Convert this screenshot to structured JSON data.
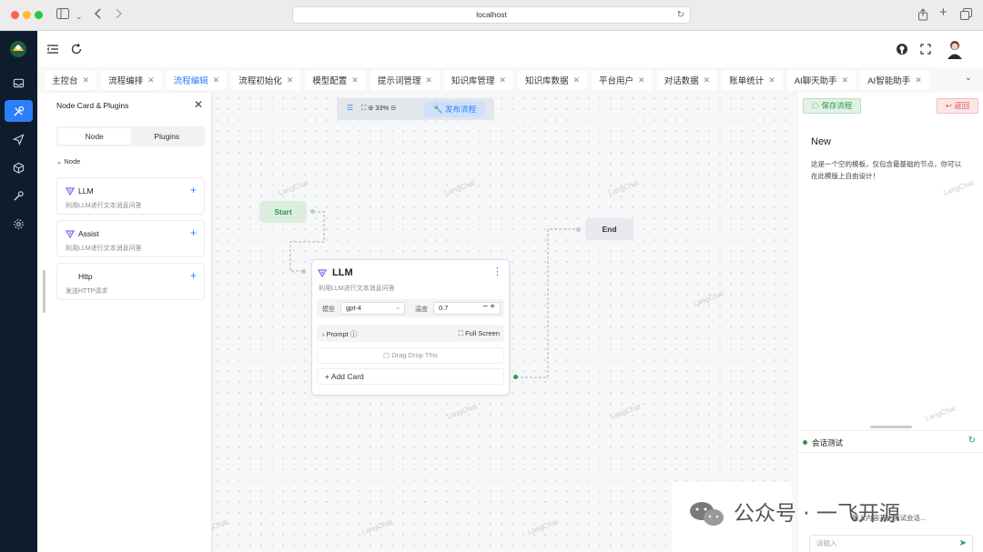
{
  "browser": {
    "url": "localhost"
  },
  "header": {},
  "tabs": [
    {
      "label": "主控台",
      "active": false
    },
    {
      "label": "流程编排",
      "active": false
    },
    {
      "label": "流程编辑",
      "active": true
    },
    {
      "label": "流程初始化",
      "active": false
    },
    {
      "label": "模型配置",
      "active": false
    },
    {
      "label": "提示词管理",
      "active": false
    },
    {
      "label": "知识库管理",
      "active": false
    },
    {
      "label": "知识库数据",
      "active": false
    },
    {
      "label": "平台用户",
      "active": false
    },
    {
      "label": "对话数据",
      "active": false
    },
    {
      "label": "账单统计",
      "active": false
    },
    {
      "label": "AI聊天助手",
      "active": false
    },
    {
      "label": "AI智能助手",
      "active": false
    }
  ],
  "left_panel": {
    "title": "Node Card & Plugins",
    "seg_node": "Node",
    "seg_plugins": "Plugins",
    "section": "Node",
    "cards": [
      {
        "title": "LLM",
        "desc": "利用LLM进行文本消息问答",
        "icon": "llm-icon"
      },
      {
        "title": "Assist",
        "desc": "利用LLM进行文本消息问答",
        "icon": "llm-icon"
      },
      {
        "title": "Http",
        "desc": "发送HTTP请求",
        "icon": ""
      }
    ]
  },
  "canvas_toolbar": {
    "zoom": "33%",
    "publish": "发布流程"
  },
  "nodes": {
    "start": "Start",
    "end": "End",
    "llm": {
      "title": "LLM",
      "desc": "利用LLM进行文本消息问答",
      "model_label": "模型",
      "model_value": "gpt-4",
      "temp_label": "温度",
      "temp_value": "0.7",
      "prompt": "Prompt",
      "fullscreen": "Full Screen",
      "drag": "Drag Drop This",
      "add_card": "Add Card"
    }
  },
  "right_panel": {
    "save": "保存流程",
    "back": "返回",
    "title": "New",
    "desc": "这是一个空的模板，仅包含最基础的节点，你可以在此模版上自由设计！",
    "chat_title": "会话测试",
    "chat_hint": "输入内容开始测试会话...",
    "chat_placeholder": "请输入"
  },
  "watermark": "LangChat",
  "overlay": {
    "wechat": "公众号 · 一飞开源"
  },
  "colors": {
    "accent": "#2d7ff9",
    "nav_bg": "#0f1c2e",
    "success": "#2b9a4a",
    "danger": "#e25555"
  }
}
